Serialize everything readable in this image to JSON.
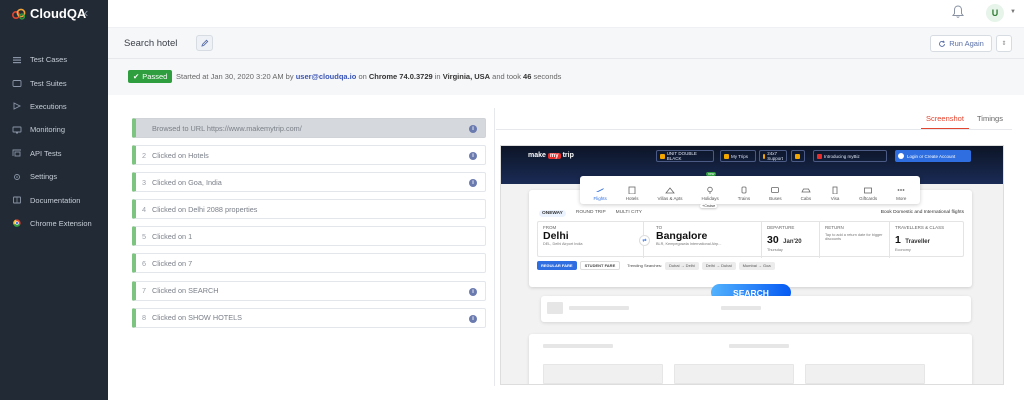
{
  "app": {
    "brand": "CloudQA",
    "brand_color": "#e2452f",
    "user_initial": "U"
  },
  "sidebar": {
    "items": [
      {
        "label": "Test Cases",
        "icon": "list-icon"
      },
      {
        "label": "Test Suites",
        "icon": "folder-icon"
      },
      {
        "label": "Executions",
        "icon": "play-icon"
      },
      {
        "label": "Monitoring",
        "icon": "monitor-icon"
      },
      {
        "label": "API Tests",
        "icon": "api-icon"
      },
      {
        "label": "Settings",
        "icon": "gear-icon"
      },
      {
        "label": "Documentation",
        "icon": "book-icon"
      },
      {
        "label": "Chrome Extension",
        "icon": "chrome-icon"
      }
    ]
  },
  "header": {
    "title": "Search hotel",
    "run_again_label": "Run Again"
  },
  "status": {
    "badge": "Passed",
    "prefix": "Started at Jan 30, 2020 3:20 AM by",
    "user": "user@cloudqa.io",
    "on": "on",
    "browser": "Chrome 74.0.3729",
    "in": "in",
    "location": "Virginia, USA",
    "took": "and took",
    "seconds_value": "46",
    "seconds_unit": "seconds"
  },
  "steps": [
    {
      "num": "",
      "text": "Browsed to URL https://www.makemytrip.com/",
      "info": true,
      "active": true
    },
    {
      "num": "2",
      "text": "Clicked on Hotels",
      "info": true,
      "active": false
    },
    {
      "num": "3",
      "text": "Clicked on Goa, India",
      "info": true,
      "active": false
    },
    {
      "num": "4",
      "text": "Clicked on Delhi 2088 properties",
      "info": false,
      "active": false
    },
    {
      "num": "5",
      "text": "Clicked on 1",
      "info": false,
      "active": false
    },
    {
      "num": "6",
      "text": "Clicked on 7",
      "info": false,
      "active": false
    },
    {
      "num": "7",
      "text": "Clicked on SEARCH",
      "info": true,
      "active": false
    },
    {
      "num": "8",
      "text": "Clicked on SHOW HOTELS",
      "info": true,
      "active": false
    }
  ],
  "tabs": {
    "screenshot": "Screenshot",
    "timings": "Timings"
  },
  "screenshot": {
    "logo_pre": "make",
    "logo_box": "my",
    "logo_post": "trip",
    "promos": [
      {
        "text": "UNIT DOUBLE BLACK"
      },
      {
        "text": "My Trips"
      },
      {
        "text": "24x7 Support"
      },
      {
        "text": ""
      },
      {
        "text": "Introducing myBiz"
      }
    ],
    "login": "Login or Create Account",
    "categories": [
      "Flights",
      "Hotels",
      "Villas & Apts",
      "Holidays",
      "Trains",
      "Buses",
      "Cabs",
      "Visa",
      "Giftcards",
      "More"
    ],
    "new_badge": "new",
    "cruise": "+Cruise",
    "trip_types": [
      "ONEWAY",
      "ROUND TRIP",
      "MULTI CITY"
    ],
    "book_intl": "Book Domestic and International flights",
    "from": {
      "label": "FROM",
      "city": "Delhi",
      "sub": "DEL, Delhi Airport India"
    },
    "to": {
      "label": "TO",
      "city": "Bangalore",
      "sub": "BLR, Kempegowda International Airp..."
    },
    "departure": {
      "label": "DEPARTURE",
      "day": "30",
      "month": "Jan'20",
      "weekday": "Thursday"
    },
    "return": {
      "label": "RETURN",
      "text": "Tap to add a return date for bigger discounts"
    },
    "travellers": {
      "label": "TRAVELLERS & CLASS",
      "count": "1",
      "unit": "Traveller",
      "class": "Economy"
    },
    "fares": [
      "REGULAR FARE",
      "STUDENT FARE"
    ],
    "trending_label": "Trending Searches:",
    "trending": [
      "Dubai → Delhi",
      "Delhi → Dubai",
      "Mumbai → Goa"
    ],
    "search_label": "SEARCH"
  }
}
